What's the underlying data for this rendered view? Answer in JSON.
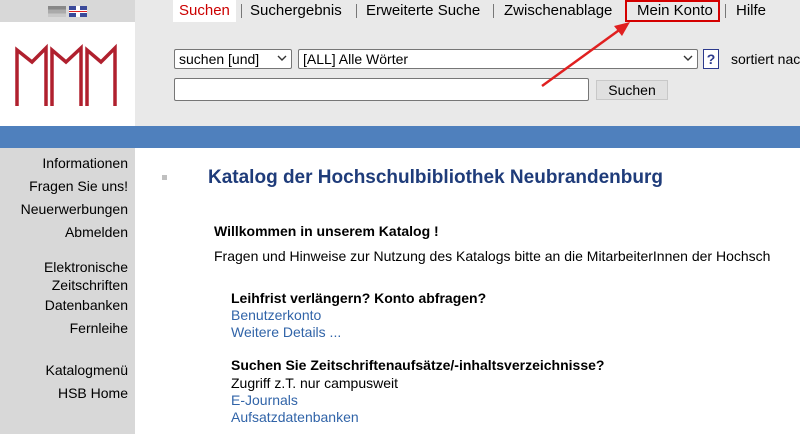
{
  "language": {
    "icons": [
      "german-flag",
      "english-flag"
    ]
  },
  "tabs": [
    {
      "label": "Suchen",
      "active": true
    },
    {
      "label": "Suchergebnis"
    },
    {
      "label": "Erweiterte Suche"
    },
    {
      "label": "Zwischenablage"
    },
    {
      "label": "Mein Konto",
      "highlighted": true
    },
    {
      "label": "Hilfe"
    }
  ],
  "search": {
    "mode_select": "suchen [und]",
    "field_select": "[ALL] Alle Wörter",
    "help_label": "?",
    "sort_label": "sortiert nac",
    "input_value": "",
    "button_label": "Suchen"
  },
  "sidebar": {
    "items": [
      {
        "label": "Informationen"
      },
      {
        "label": "Fragen Sie uns!"
      },
      {
        "label": "Neuerwerbungen"
      },
      {
        "label": "Abmelden"
      },
      {
        "label": "Elektronische"
      },
      {
        "label": "Zeitschriften"
      },
      {
        "label": "Datenbanken"
      },
      {
        "label": "Fernleihe"
      },
      {
        "label": "Katalogmenü"
      },
      {
        "label": "HSB Home"
      }
    ]
  },
  "main": {
    "title": "Katalog der Hochschulbibliothek Neubrandenburg",
    "welcome": "Willkommen in unserem Katalog !",
    "intro": "Fragen und Hinweise zur Nutzung des Katalogs bitte an die MitarbeiterInnen der Hochsch",
    "section1": {
      "heading": "Leihfrist verlängern? Konto abfragen?",
      "links": [
        "Benutzerkonto",
        "Weitere Details ..."
      ]
    },
    "section2": {
      "heading": "Suchen Sie Zeitschriftenaufsätze/-inhaltsverzeichnisse?",
      "note": "Zugriff z.T. nur campusweit",
      "links": [
        "E-Journals",
        "Aufsatzdatenbanken"
      ]
    }
  },
  "colors": {
    "accent_blue": "#4f80bd",
    "active_tab": "#cc0000",
    "highlight": "#d40000",
    "link": "#3164a8",
    "title": "#1f3c7a",
    "logo": "#b0202e"
  }
}
